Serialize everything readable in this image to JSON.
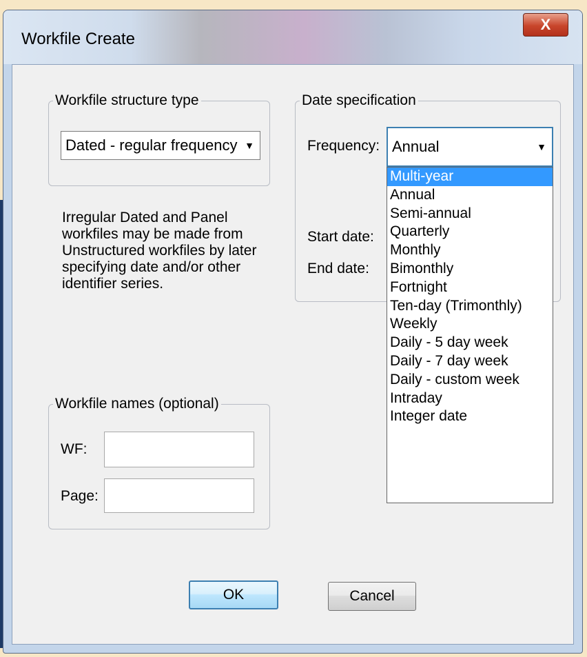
{
  "window": {
    "title": "Workfile Create",
    "close_label": "X"
  },
  "structure_group": {
    "legend": "Workfile structure type",
    "selected": "Dated - regular frequency",
    "note": "Irregular Dated and Panel workfiles may be made from Unstructured workfiles by later specifying date and/or other identifier series."
  },
  "date_group": {
    "legend": "Date specification",
    "frequency_label": "Frequency:",
    "frequency_selected": "Annual",
    "start_label": "Start date:",
    "end_label": "End date:"
  },
  "frequency_options": [
    "Multi-year",
    "Annual",
    "Semi-annual",
    "Quarterly",
    "Monthly",
    "Bimonthly",
    "Fortnight",
    "Ten-day (Trimonthly)",
    "Weekly",
    "Daily - 5 day week",
    "Daily - 7 day week",
    "Daily - custom week",
    "Intraday",
    "Integer date"
  ],
  "names_group": {
    "legend": "Workfile names (optional)",
    "wf_label": "WF:",
    "page_label": "Page:",
    "wf_value": "",
    "page_value": ""
  },
  "buttons": {
    "ok": "OK",
    "cancel": "Cancel"
  },
  "colors": {
    "highlight": "#3399ff",
    "close_button": "#c8452b",
    "ok_border": "#3c7fb1"
  }
}
